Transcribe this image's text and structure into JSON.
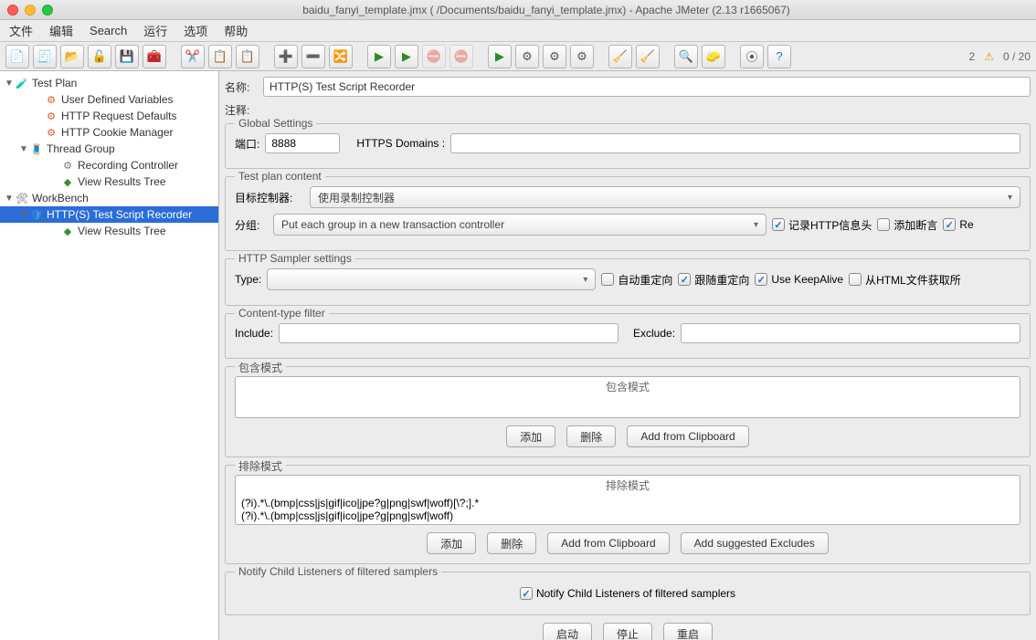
{
  "window": {
    "title": "baidu_fanyi_template.jmx (          /Documents/baidu_fanyi_template.jmx) - Apache JMeter (2.13 r1665067)"
  },
  "menu": {
    "file": "文件",
    "edit": "编辑",
    "search": "Search",
    "run": "运行",
    "options": "选项",
    "help": "帮助"
  },
  "status": {
    "left_num": "2",
    "right": "0 / 20"
  },
  "tree": {
    "testplan": "Test Plan",
    "udv": "User Defined Variables",
    "reqdef": "HTTP Request Defaults",
    "cookie": "HTTP Cookie Manager",
    "tg": "Thread Group",
    "rec": "Recording Controller",
    "vrt1": "View Results Tree",
    "wb": "WorkBench",
    "recorder": "HTTP(S) Test Script Recorder",
    "vrt2": "View Results Tree"
  },
  "form": {
    "name_label": "名称:",
    "name_value": "HTTP(S) Test Script Recorder",
    "comment_label": "注释:",
    "comment_value": ""
  },
  "global": {
    "legend": "Global Settings",
    "port_label": "端口:",
    "port_value": "8888",
    "domains_label": "HTTPS Domains :",
    "domains_value": ""
  },
  "plan": {
    "legend": "Test plan content",
    "target_label": "目标控制器:",
    "target_value": "使用录制控制器",
    "group_label": "分组:",
    "group_value": "Put each group in a new transaction controller",
    "chk_headers": "记录HTTP信息头",
    "chk_assert": "添加断言",
    "chk_re": "Re"
  },
  "sampler": {
    "legend": "HTTP Sampler settings",
    "type_label": "Type:",
    "type_value": "",
    "chk_auto": "自动重定向",
    "chk_follow": "跟随重定向",
    "chk_keep": "Use KeepAlive",
    "chk_html": "从HTML文件获取所"
  },
  "ctfilter": {
    "legend": "Content-type filter",
    "include_label": "Include:",
    "include_value": "",
    "exclude_label": "Exclude:",
    "exclude_value": ""
  },
  "include_patterns": {
    "legend": "包含模式",
    "header": "包含模式",
    "btn_add": "添加",
    "btn_del": "删除",
    "btn_clip": "Add from Clipboard"
  },
  "exclude_patterns": {
    "legend": "排除模式",
    "header": "排除模式",
    "row1": "(?i).*\\.(bmp|css|js|gif|ico|jpe?g|png|swf|woff)[\\?;].*",
    "row2": "(?i).*\\.(bmp|css|js|gif|ico|jpe?g|png|swf|woff)",
    "btn_add": "添加",
    "btn_del": "删除",
    "btn_clip": "Add from Clipboard",
    "btn_sugg": "Add suggested Excludes"
  },
  "notify": {
    "legend": "Notify Child Listeners of filtered samplers",
    "chk": "Notify Child Listeners of filtered samplers"
  },
  "lifecycle": {
    "start": "启动",
    "stop": "停止",
    "restart": "重启"
  }
}
